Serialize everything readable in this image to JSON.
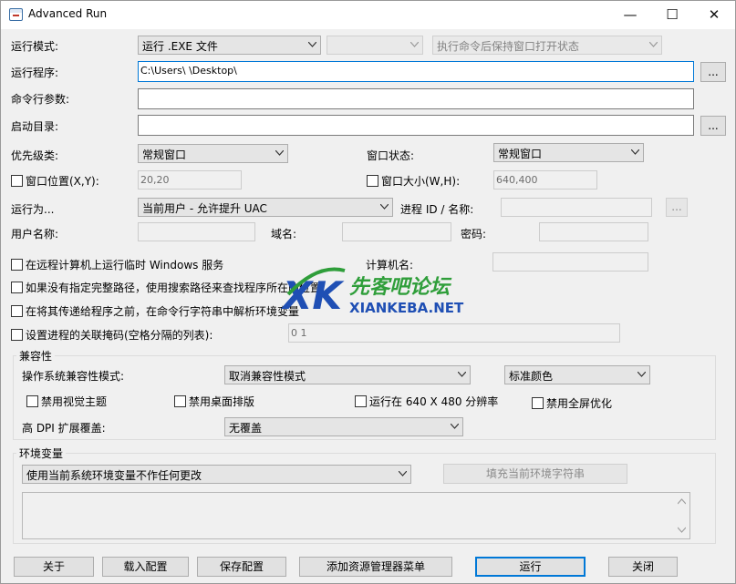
{
  "window": {
    "title": "Advanced Run",
    "minimize": "—",
    "maximize": "☐",
    "close": "✕"
  },
  "labels": {
    "run_mode": "运行模式:",
    "program": "运行程序:",
    "cmd_args": "命令行参数:",
    "start_dir": "启动目录:",
    "priority": "优先级类:",
    "window_state": "窗口状态:",
    "run_as": "运行为...",
    "process_id": "进程 ID / 名称:",
    "username": "用户名称:",
    "domain": "域名:",
    "password": "密码:",
    "computer_name": "计算机名:",
    "os_compat_mode": "操作系统兼容性模式:",
    "high_dpi": "高 DPI 扩展覆盖:"
  },
  "fields": {
    "run_mode_value": "运行 .EXE 文件",
    "run_mode_second_value": "",
    "keep_window_value": "执行命令后保持窗口打开状态",
    "program_path": "C:\\Users\\                    \\Desktop\\",
    "cmd_args_value": "",
    "start_dir_value": "",
    "priority_value": "常规窗口",
    "window_state_value": "常规窗口",
    "window_pos_value": "20,20",
    "window_size_value": "640,400",
    "run_as_value": "当前用户 - 允许提升 UAC",
    "process_id_value": "",
    "username_value": "",
    "domain_value": "",
    "password_value": "",
    "computer_name_value": "",
    "affinity_value": "0 1",
    "os_compat_value": "取消兼容性模式",
    "color_value": "标准颜色",
    "high_dpi_value": "无覆盖",
    "env_mode_value": "使用当前系统环境变量不作任何更改"
  },
  "checkboxes": {
    "window_pos": "窗口位置(X,Y):",
    "window_size": "窗口大小(W,H):",
    "remote_service": "在远程计算机上运行临时 Windows 服务",
    "search_path": "如果没有指定完整路径，使用搜索路径来查找程序所在的位置",
    "parse_env": "在将其传递给程序之前，在命令行字符串中解析环境变量",
    "affinity": "设置进程的关联掩码(空格分隔的列表):",
    "disable_visual_themes": "禁用视觉主题",
    "disable_desktop_composition": "禁用桌面排版",
    "run_640x480": "运行在 640 X 480 分辨率",
    "disable_fullscreen_opt": "禁用全屏优化"
  },
  "groups": {
    "compat": "兼容性",
    "env": "环境变量"
  },
  "buttons": {
    "browse": "...",
    "fill_env": "填充当前环境字符串",
    "about": "关于",
    "load_config": "载入配置",
    "save_config": "保存配置",
    "add_explorer_menu": "添加资源管理器菜单",
    "run": "运行",
    "close": "关闭"
  },
  "watermark": {
    "logo": "XK",
    "name": "先客吧论坛",
    "site": "XIANKEBA.NET"
  },
  "colors": {
    "accent": "#0078d7",
    "watermark_blue": "#1f4fb4",
    "watermark_green": "#2f9e3a"
  }
}
